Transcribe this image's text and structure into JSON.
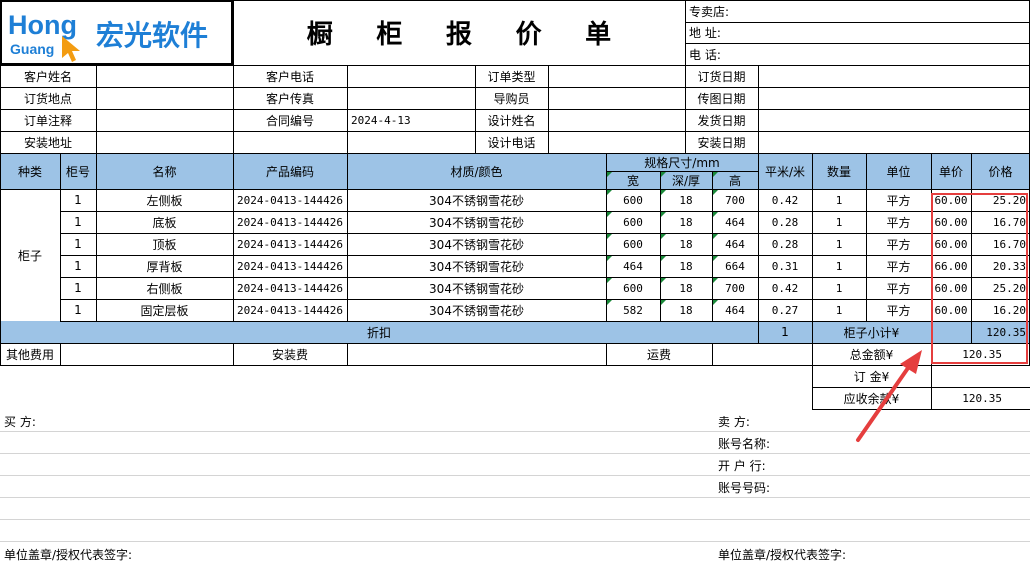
{
  "logo": {
    "en_top": "Hong",
    "en_bottom": "Guang",
    "cn": "宏光软件"
  },
  "title_chars": [
    "橱",
    "柜",
    "报",
    "价",
    "单"
  ],
  "store_info": {
    "store": "专卖店:",
    "address": "地  址:",
    "phone": "电  话:"
  },
  "info": {
    "customer_name": "客户姓名",
    "customer_phone": "客户电话",
    "order_type": "订单类型",
    "order_date": "订货日期",
    "order_place": "订货地点",
    "customer_fax": "客户传真",
    "guide": "导购员",
    "fax_date": "传图日期",
    "order_note": "订单注释",
    "contract_no": "合同编号",
    "contract_value": "2024-4-13",
    "designer": "设计姓名",
    "ship_date": "发货日期",
    "install_addr": "安装地址",
    "design_phone": "设计电话",
    "install_date": "安装日期"
  },
  "headers": {
    "kind": "种类",
    "cab_no": "柜号",
    "name": "名称",
    "code": "产品编码",
    "material": "材质/颜色",
    "spec": "规格尺寸/mm",
    "width": "宽",
    "depth": "深/厚",
    "height": "高",
    "area": "平米/米",
    "qty": "数量",
    "unit": "单位",
    "price": "单价",
    "amount": "价格"
  },
  "category": "柜子",
  "rows": [
    {
      "no": "1",
      "name": "左侧板",
      "code": "2024-0413-144426",
      "material": "304不锈钢雪花砂",
      "w": "600",
      "d": "18",
      "h": "700",
      "area": "0.42",
      "qty": "1",
      "unit": "平方",
      "price": "60.00",
      "amount": "25.20"
    },
    {
      "no": "1",
      "name": "底板",
      "code": "2024-0413-144426",
      "material": "304不锈钢雪花砂",
      "w": "600",
      "d": "18",
      "h": "464",
      "area": "0.28",
      "qty": "1",
      "unit": "平方",
      "price": "60.00",
      "amount": "16.70"
    },
    {
      "no": "1",
      "name": "顶板",
      "code": "2024-0413-144426",
      "material": "304不锈钢雪花砂",
      "w": "600",
      "d": "18",
      "h": "464",
      "area": "0.28",
      "qty": "1",
      "unit": "平方",
      "price": "60.00",
      "amount": "16.70"
    },
    {
      "no": "1",
      "name": "厚背板",
      "code": "2024-0413-144426",
      "material": "304不锈钢雪花砂",
      "w": "464",
      "d": "18",
      "h": "664",
      "area": "0.31",
      "qty": "1",
      "unit": "平方",
      "price": "66.00",
      "amount": "20.33"
    },
    {
      "no": "1",
      "name": "右侧板",
      "code": "2024-0413-144426",
      "material": "304不锈钢雪花砂",
      "w": "600",
      "d": "18",
      "h": "700",
      "area": "0.42",
      "qty": "1",
      "unit": "平方",
      "price": "60.00",
      "amount": "25.20"
    },
    {
      "no": "1",
      "name": "固定层板",
      "code": "2024-0413-144426",
      "material": "304不锈钢雪花砂",
      "w": "582",
      "d": "18",
      "h": "464",
      "area": "0.27",
      "qty": "1",
      "unit": "平方",
      "price": "60.00",
      "amount": "16.20"
    }
  ],
  "discount": {
    "label": "折扣",
    "qty": "1",
    "subtotal_label": "柜子小计¥",
    "subtotal": "120.35"
  },
  "fees": {
    "other": "其他费用",
    "install": "安装费",
    "freight": "运费",
    "total_label": "总金额¥",
    "total": "120.35"
  },
  "deposit": {
    "label": "订   金¥"
  },
  "receivable": {
    "label": "应收余款¥",
    "value": "120.35"
  },
  "buyer": {
    "label": "买      方:"
  },
  "seller": {
    "label": "卖      方:",
    "account_name": "账号名称:",
    "bank": "开 户 行:",
    "account_no": "账号号码:"
  },
  "seal_left": "单位盖章/授权代表签字:",
  "seal_right": "单位盖章/授权代表签字:",
  "colors": {
    "header_blue": "#9dc3e6",
    "logo_blue": "#1e7fd6",
    "logo_orange": "#f39c12",
    "highlight_red": "#e53e3e"
  }
}
